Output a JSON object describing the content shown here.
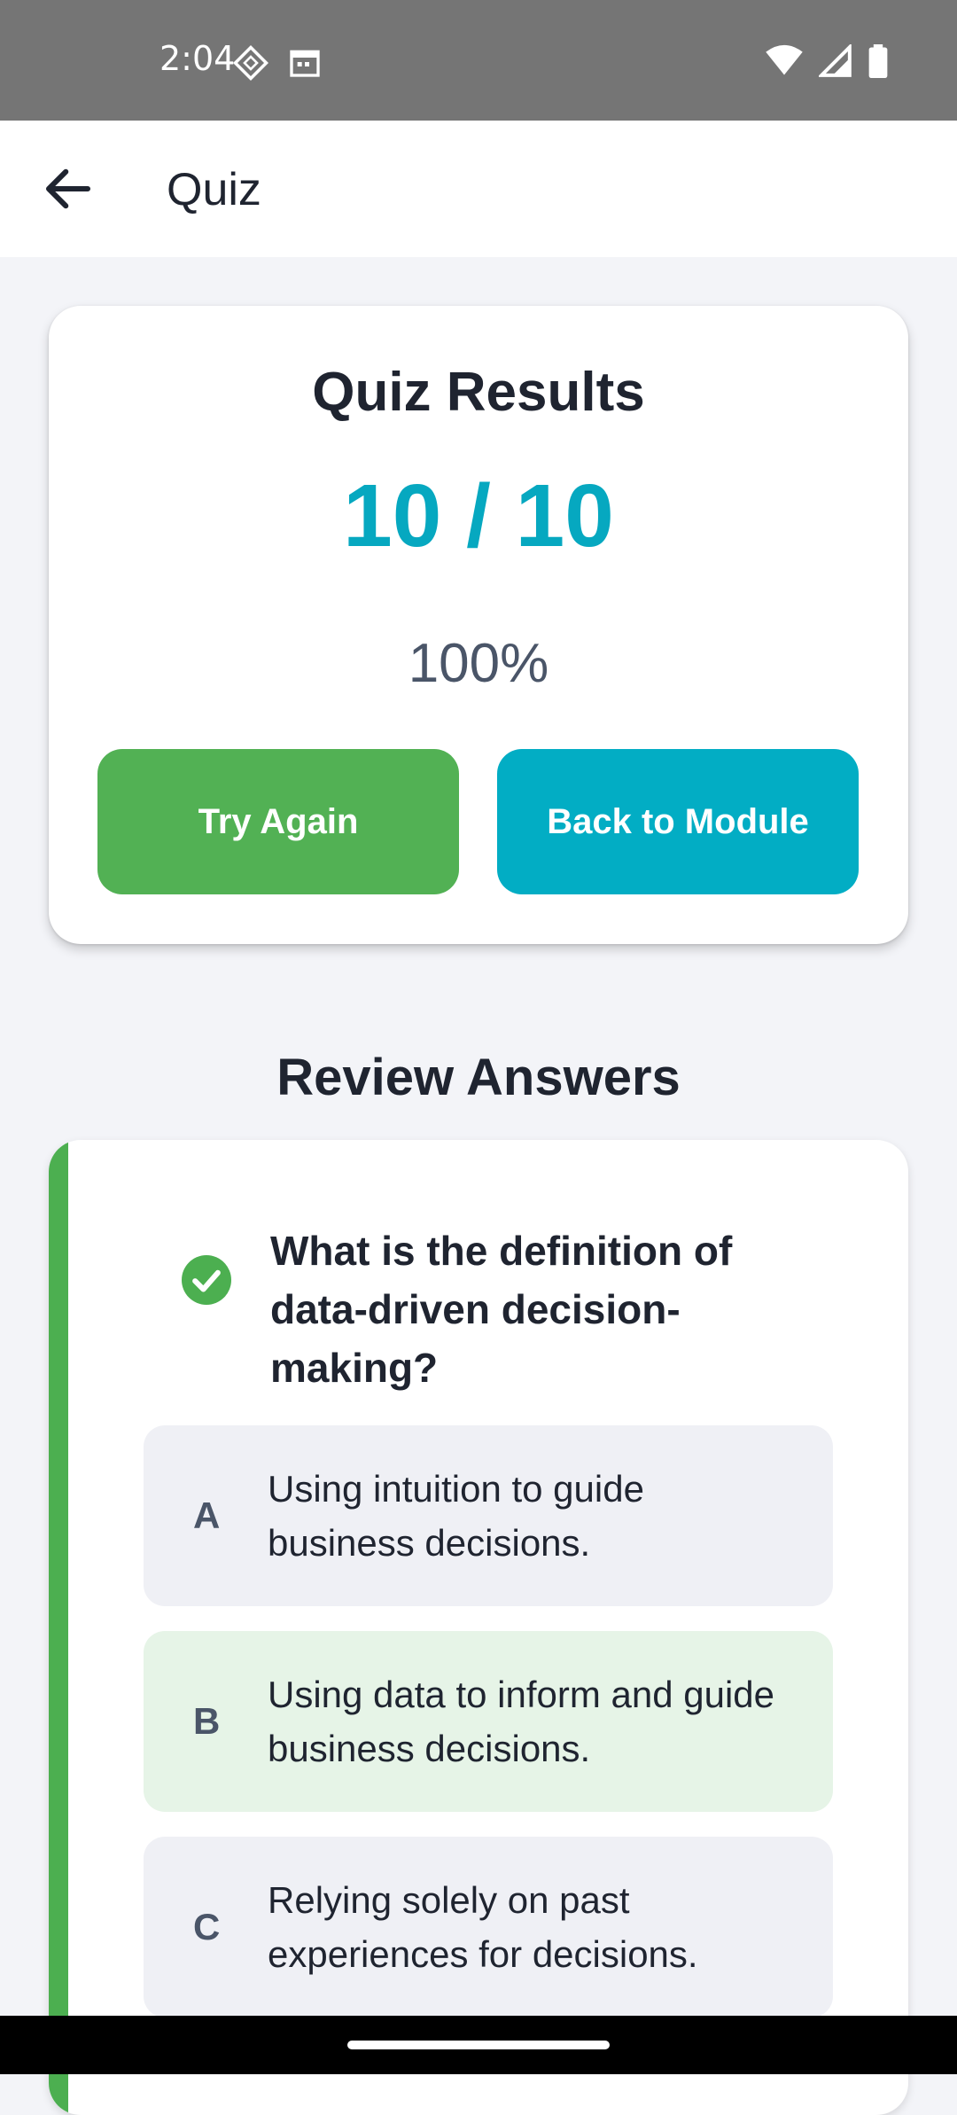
{
  "status_bar": {
    "time": "2:04",
    "left_icons": [
      "sync-diamond-icon",
      "calendar-icon"
    ],
    "right_icons": [
      "wifi-icon",
      "signal-icon",
      "battery-icon"
    ]
  },
  "app_bar": {
    "title": "Quiz",
    "back_icon": "arrow-back-icon"
  },
  "results": {
    "title": "Quiz Results",
    "score": "10 / 10",
    "percent": "100%",
    "try_again_label": "Try Again",
    "back_to_module_label": "Back to Module"
  },
  "review": {
    "section_title": "Review Answers",
    "questions": [
      {
        "status_icon": "check-circle-icon",
        "text": "What is the definition of data-driven decision-making?",
        "options": [
          {
            "letter": "A",
            "text": "Using intuition to guide business decisions.",
            "state": "default"
          },
          {
            "letter": "B",
            "text": "Using data to inform and guide business decisions.",
            "state": "correct"
          },
          {
            "letter": "C",
            "text": "Relying solely on past experiences for decisions.",
            "state": "default"
          }
        ]
      }
    ]
  },
  "colors": {
    "accent_teal": "#02adc4",
    "success_green": "#52b154",
    "correct_option_bg": "#e6f4e7",
    "status_bar_bg": "#757575"
  }
}
